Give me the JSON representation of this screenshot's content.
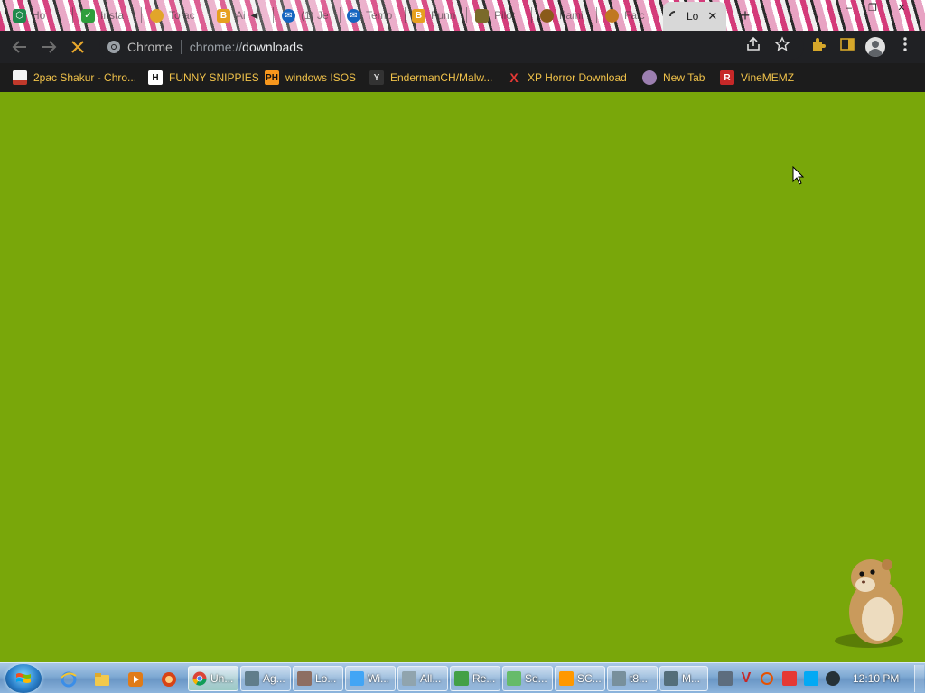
{
  "browser": {
    "tabs": [
      {
        "title": "Ho",
        "fav_color": "#1f8a4c"
      },
      {
        "title": "Insta",
        "fav_color": "#2e9e3c"
      },
      {
        "title": "To ac",
        "fav_color": "#e2a52a"
      },
      {
        "title": "Ai",
        "fav_color": "#e6a020"
      },
      {
        "title": "(1) Je",
        "fav_color": "#1565c0"
      },
      {
        "title": "Temp",
        "fav_color": "#1565c0"
      },
      {
        "title": "Funn",
        "fav_color": "#e6a020"
      },
      {
        "title": "Pilot",
        "fav_color": "#7a6a2a"
      },
      {
        "title": "Fami",
        "fav_color": "#8a5a1a"
      },
      {
        "title": "Falc",
        "fav_color": "#c07820"
      },
      {
        "title": "Lo",
        "fav_color": "#555555",
        "active": true
      }
    ],
    "new_tab_label": "+",
    "window_controls": {
      "minimize": "–",
      "maximize": "❐",
      "close": "✕"
    },
    "omnibox": {
      "chip_label": "Chrome",
      "url_scheme": "chrome://",
      "url_path": "downloads"
    },
    "bookmarks": [
      {
        "label": "2pac Shakur - Chro...",
        "icon_text": "",
        "icon_color": "#c0392b"
      },
      {
        "label": "FUNNY SNIPPIES",
        "icon_text": "H",
        "icon_color": "#ffffff"
      },
      {
        "label": "windows ISOS",
        "icon_text": "PH",
        "icon_color": "#f7971d"
      },
      {
        "label": "EndermanCH/Malw...",
        "icon_text": "Y",
        "icon_color": "#333333"
      },
      {
        "label": "XP Horror Download",
        "icon_text": "X",
        "icon_color": "#e53935"
      },
      {
        "label": "New Tab",
        "icon_text": "",
        "icon_color": "#9c7fb0"
      },
      {
        "label": "VineMEMZ",
        "icon_text": "R",
        "icon_color": "#c62828"
      }
    ]
  },
  "page": {
    "background": "#79a70a",
    "loading": true
  },
  "taskbar": {
    "tasks": [
      {
        "label": "Un...",
        "icon_color": "#4caf50",
        "active": true
      },
      {
        "label": "Ag...",
        "icon_color": "#607d8b"
      },
      {
        "label": "Lo...",
        "icon_color": "#8d6e63"
      },
      {
        "label": "Wi...",
        "icon_color": "#42a5f5"
      },
      {
        "label": "All...",
        "icon_color": "#90a4ae"
      },
      {
        "label": "Re...",
        "icon_color": "#43a047"
      },
      {
        "label": "Se...",
        "icon_color": "#66bb6a"
      },
      {
        "label": "SC...",
        "icon_color": "#ff9800"
      },
      {
        "label": "t8...",
        "icon_color": "#78909c"
      },
      {
        "label": "M...",
        "icon_color": "#546e7a"
      }
    ],
    "clock": "12:10 PM"
  }
}
